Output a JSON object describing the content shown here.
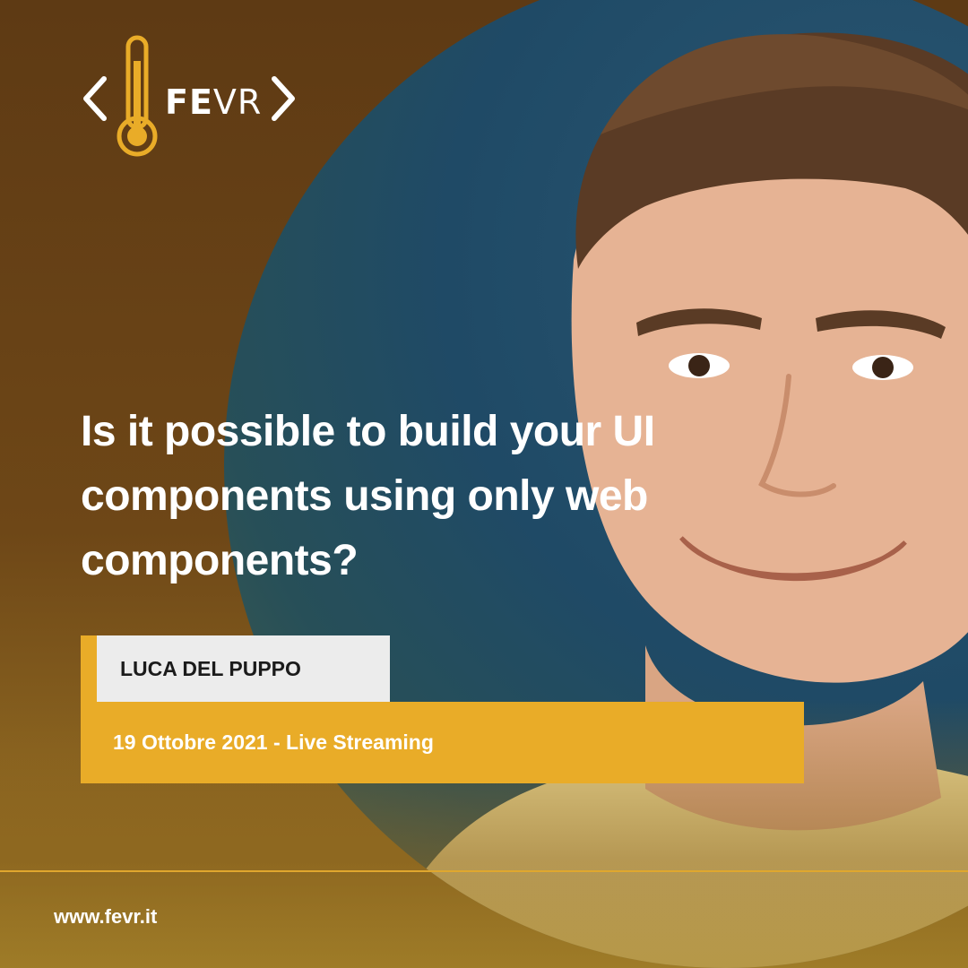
{
  "brand": {
    "logo_bold": "FE",
    "logo_light": "VR"
  },
  "headline": "Is it possible to build your UI components using only web components?",
  "speaker": {
    "name": "LUCA DEL PUPPO"
  },
  "event": {
    "date_line": "19 Ottobre 2021 - Live Streaming"
  },
  "footer": {
    "website": "www.fevr.it"
  },
  "colors": {
    "accent": "#e9ac28",
    "background": "#5e3a14",
    "photo_bg": "#1f4a66"
  }
}
